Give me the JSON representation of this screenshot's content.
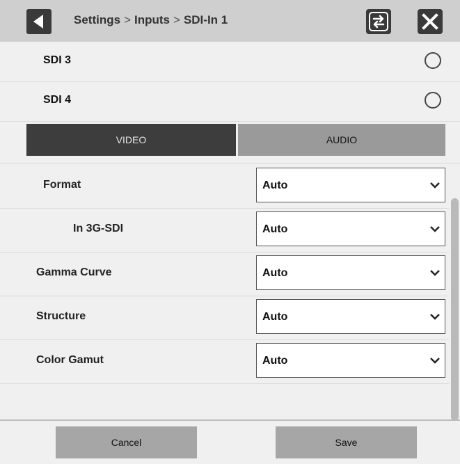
{
  "header": {
    "breadcrumb": [
      "Settings",
      "Inputs",
      "SDI-In 1"
    ],
    "separator": ">",
    "back_icon": "back-triangle-icon",
    "swap_icon": "swap-arrows-icon",
    "close_icon": "close-x-icon"
  },
  "sdi_inputs": [
    {
      "label": "SDI 3",
      "selected": false
    },
    {
      "label": "SDI 4",
      "selected": false
    }
  ],
  "tabs": [
    {
      "label": "VIDEO",
      "active": true
    },
    {
      "label": "AUDIO",
      "active": false
    }
  ],
  "settings": [
    {
      "label": "Format",
      "value": "Auto",
      "indent": false
    },
    {
      "label": "In 3G-SDI",
      "value": "Auto",
      "indent": true
    },
    {
      "label": "Gamma Curve",
      "value": "Auto",
      "indent": false
    },
    {
      "label": "Structure",
      "value": "Auto",
      "indent": false
    },
    {
      "label": "Color Gamut",
      "value": "Auto",
      "indent": false
    }
  ],
  "footer": {
    "cancel_label": "Cancel",
    "save_label": "Save"
  },
  "colors": {
    "header_bg": "#cfcfcf",
    "button_dark": "#3a3a3a",
    "tab_active": "#3d3d3d",
    "tab_inactive": "#9a9a9a",
    "footer_button": "#a6a6a6"
  }
}
